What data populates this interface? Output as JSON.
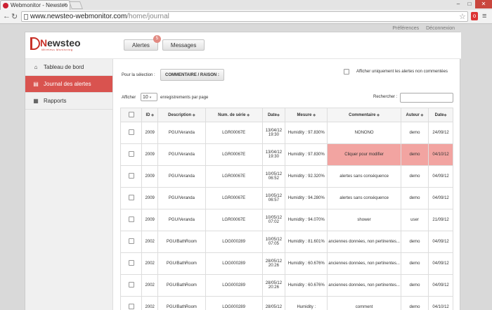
{
  "browser": {
    "tab_title": "Webmonitor - Newsteo",
    "close_glyph": "×",
    "url_host": "www.newsteo-webmonitor.com",
    "url_path": "/home/journal"
  },
  "top_links": {
    "preferences": "Préférences",
    "logout": "Déconnexion"
  },
  "logo": {
    "prefix": "N",
    "word": "ewsteo",
    "tagline": "Wireless Monitoring"
  },
  "top_tabs": {
    "alerts": "Alertes",
    "alerts_badge": "5",
    "messages": "Messages"
  },
  "sidebar": {
    "items": [
      {
        "label": "Tableau de bord",
        "icon": "home-icon"
      },
      {
        "label": "Journal des alertes",
        "icon": "list-icon",
        "active": true
      },
      {
        "label": "Rapports",
        "icon": "briefcase-icon"
      }
    ]
  },
  "toolbar": {
    "selection_label": "Pour la sélection :",
    "comment_button": "COMMENTAIRE / RAISON :",
    "only_uncommented": "Afficher uniquement les alertes non commentées",
    "show_label": "Afficher",
    "page_length": "10",
    "per_page": "enregistrements par page",
    "search_label": "Rechercher :"
  },
  "table": {
    "headers": [
      "ID",
      "Description",
      "Num. de série",
      "Date",
      "Mesure",
      "Commentaire",
      "Auteur",
      "Date"
    ],
    "rows": [
      {
        "id": "2009",
        "desc": "PGU/Veranda",
        "serial": "LGR00067E",
        "date": "13/04/12 19:30",
        "measure": "Humidity : 97.830%",
        "comment": "NONONO",
        "author": "demo",
        "date2": "24/09/12"
      },
      {
        "id": "2009",
        "desc": "PGU/Veranda",
        "serial": "LGR00067E",
        "date": "13/04/12 19:30",
        "measure": "Humidity : 97.830%",
        "comment": "Cliquer pour modifier",
        "author": "demo",
        "date2": "04/10/12",
        "highlight": true
      },
      {
        "id": "2009",
        "desc": "PGU/Veranda",
        "serial": "LGR00067E",
        "date": "10/05/12 06:52",
        "measure": "Humidity : 92.320%",
        "comment": "alertes sans conséquence",
        "author": "demo",
        "date2": "04/09/12"
      },
      {
        "id": "2009",
        "desc": "PGU/Veranda",
        "serial": "LGR00067E",
        "date": "10/05/12 06:57",
        "measure": "Humidity : 94.280%",
        "comment": "alertes sans conséquence",
        "author": "demo",
        "date2": "04/09/12"
      },
      {
        "id": "2009",
        "desc": "PGU/Veranda",
        "serial": "LGR00067E",
        "date": "10/05/12 07:02",
        "measure": "Humidity : 94.070%",
        "comment": "shower",
        "author": "user",
        "date2": "21/09/12"
      },
      {
        "id": "2002",
        "desc": "PGU/BathRoom",
        "serial": "LOG000289",
        "date": "10/05/12 07:05",
        "measure": "Humidity : 81.601%",
        "comment": "anciennes données, non pertinentes...",
        "author": "demo",
        "date2": "04/09/12"
      },
      {
        "id": "2002",
        "desc": "PGU/BathRoom",
        "serial": "LOG000289",
        "date": "28/05/12 20:26",
        "measure": "Humidity : 60.676%",
        "comment": "anciennes données, non pertinentes...",
        "author": "demo",
        "date2": "04/09/12"
      },
      {
        "id": "2002",
        "desc": "PGU/BathRoom",
        "serial": "LOG000289",
        "date": "28/05/12 20:26",
        "measure": "Humidity : 60.676%",
        "comment": "anciennes données, non pertinentes...",
        "author": "demo",
        "date2": "04/09/12"
      },
      {
        "id": "2002",
        "desc": "PGU/BathRoom",
        "serial": "LOG000289",
        "date": "28/05/12",
        "measure": "Humidity :",
        "comment": "comment",
        "author": "demo",
        "date2": "04/10/12"
      }
    ]
  },
  "colors": {
    "accent": "#d9534f",
    "highlight_row": "#f2a4a1",
    "logo_red": "#c83128"
  }
}
